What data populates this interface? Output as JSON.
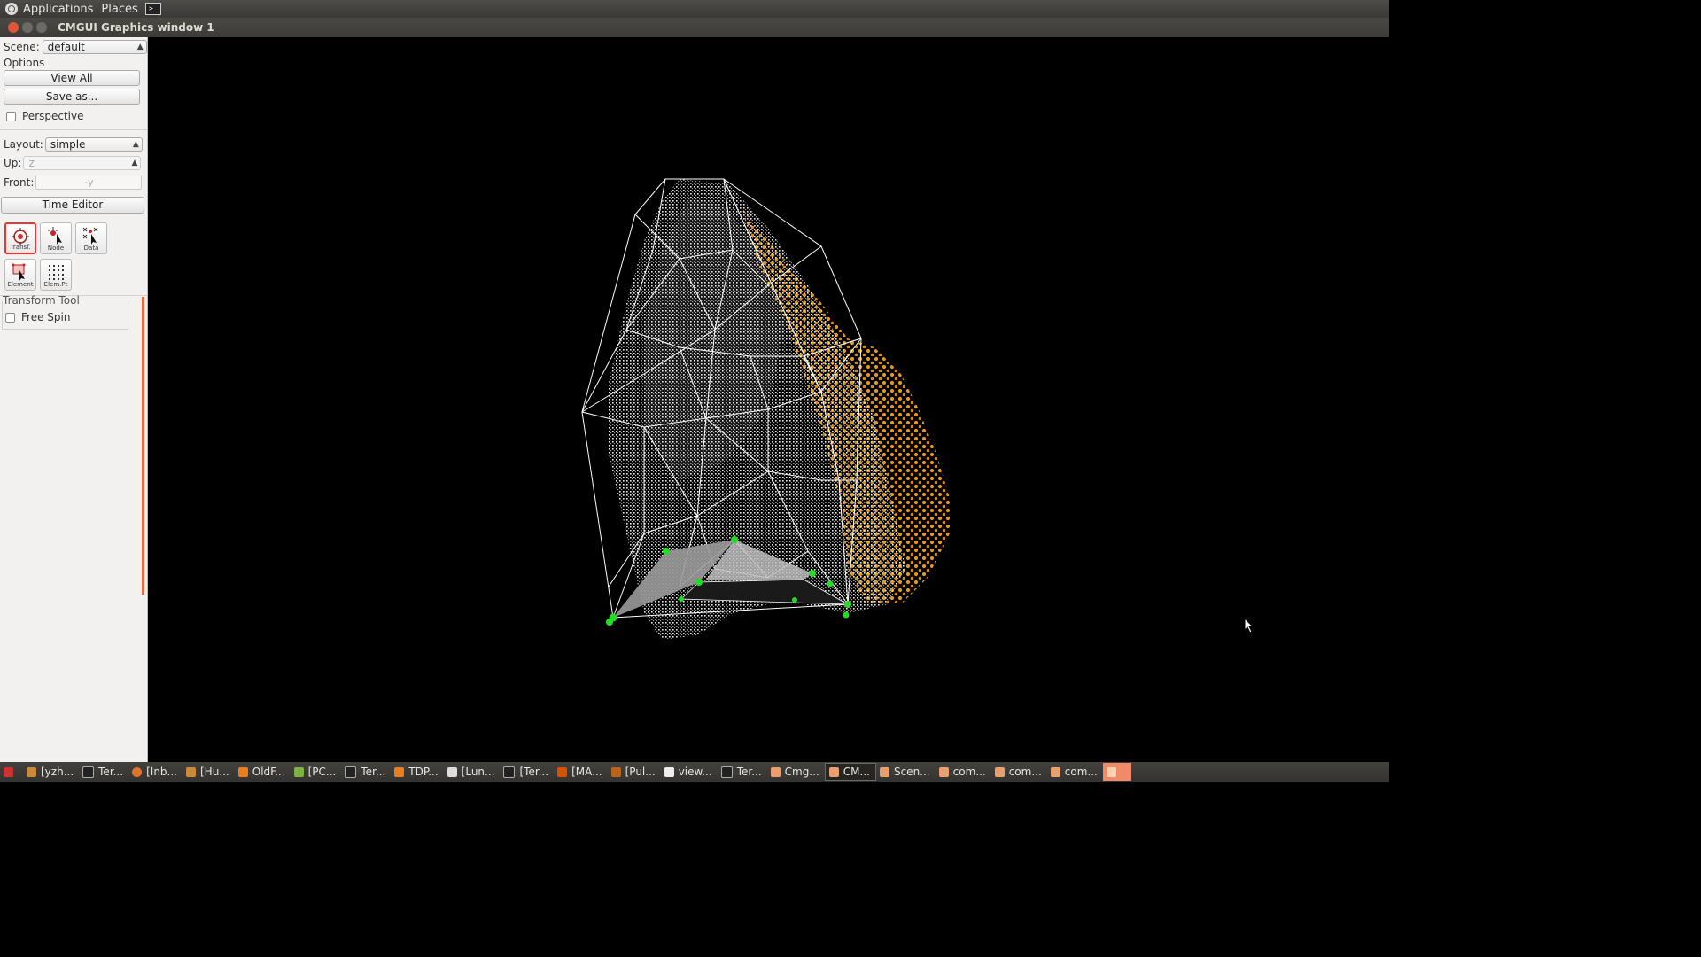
{
  "top_panel": {
    "applications": "Applications",
    "places": "Places"
  },
  "window": {
    "title": "CMGUI Graphics window 1"
  },
  "sidebar": {
    "scene_label": "Scene:",
    "scene_value": "default",
    "options_label": "Options",
    "view_all": "View All",
    "save_as": "Save as...",
    "perspective": "Perspective",
    "layout_label": "Layout:",
    "layout_value": "simple",
    "up_label": "Up:",
    "up_value": "z",
    "front_label": "Front:",
    "front_value": "-y",
    "time_editor": "Time Editor",
    "tools": [
      {
        "label": "Transf."
      },
      {
        "label": "Node"
      },
      {
        "label": "Data"
      },
      {
        "label": "Element"
      },
      {
        "label": "Elem.Pt"
      }
    ],
    "transform_tool_label": "Transform Tool",
    "free_spin": "Free Spin"
  },
  "taskbar": {
    "items": [
      {
        "label": "[yzh..."
      },
      {
        "label": "Ter..."
      },
      {
        "label": "[Inb..."
      },
      {
        "label": "[Hu..."
      },
      {
        "label": "OldF..."
      },
      {
        "label": "[PC..."
      },
      {
        "label": "Ter..."
      },
      {
        "label": "TDP..."
      },
      {
        "label": "[Lun..."
      },
      {
        "label": "[Ter..."
      },
      {
        "label": "[MA..."
      },
      {
        "label": "[Pul..."
      },
      {
        "label": "view..."
      },
      {
        "label": "Ter..."
      },
      {
        "label": "Cmg..."
      },
      {
        "label": "CM..."
      },
      {
        "label": "Scen..."
      },
      {
        "label": "com..."
      },
      {
        "label": "com..."
      },
      {
        "label": "com..."
      }
    ]
  },
  "colors": {
    "accent": "#e76a3e",
    "data_points": "#f0a020",
    "nodes": "#22dd22",
    "mesh_lines": "#ffffff"
  }
}
